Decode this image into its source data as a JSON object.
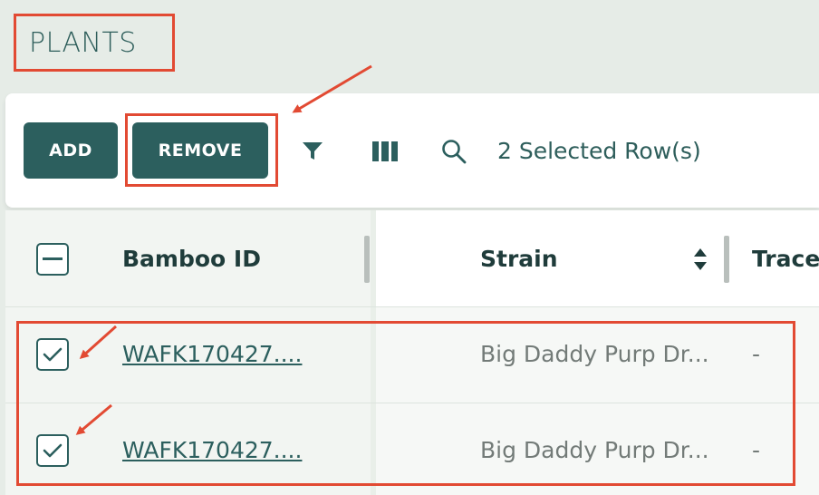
{
  "page": {
    "title": "PLANTS"
  },
  "toolbar": {
    "add_label": "ADD",
    "remove_label": "REMOVE",
    "selected_text": "2 Selected Row(s)",
    "icons": [
      "filter-icon",
      "columns-icon",
      "search-icon"
    ]
  },
  "table": {
    "columns": [
      "Bamboo ID",
      "Strain",
      "Trace"
    ],
    "rows": [
      {
        "selected": true,
        "bamboo_id": "WAFK170427....",
        "strain": "Big Daddy Purp Dr...",
        "trace": "-"
      },
      {
        "selected": true,
        "bamboo_id": "WAFK170427....",
        "strain": "Big Daddy Purp Dr...",
        "trace": "-"
      }
    ]
  },
  "colors": {
    "primary": "#2c5f5e",
    "annotation": "#e24a33",
    "background": "#e6ece7"
  }
}
